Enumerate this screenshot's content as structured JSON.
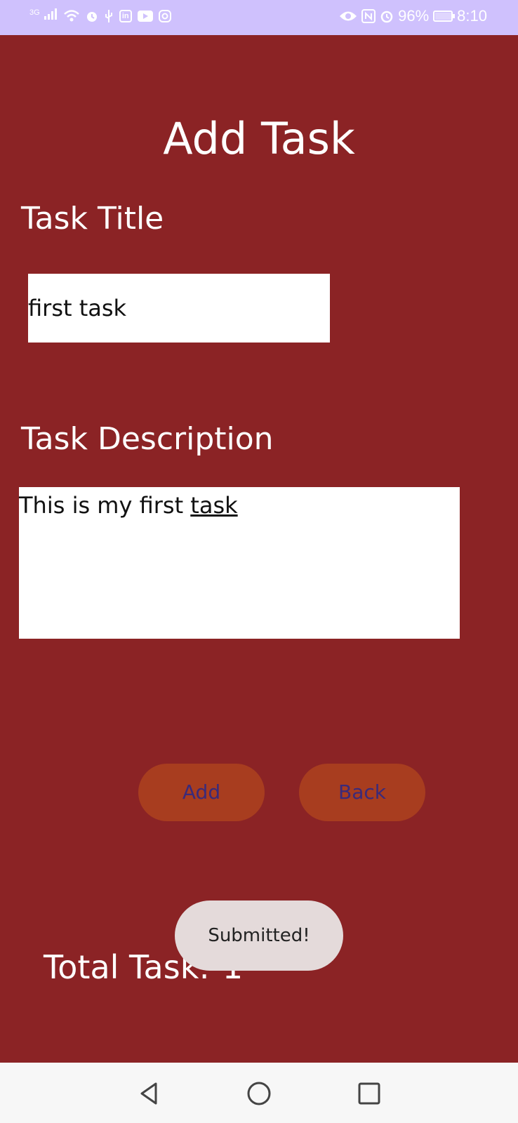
{
  "status_bar": {
    "network_type": "3G",
    "battery_percent": "96%",
    "time": "8:10",
    "background_color": "#cfc1fd",
    "icons": [
      "signal-icon",
      "wifi-icon",
      "alarm-icon",
      "usb-icon",
      "linkedin-icon",
      "youtube-icon",
      "instagram-icon",
      "eye-icon",
      "nfc-icon",
      "alarm-icon",
      "battery-icon"
    ]
  },
  "screen": {
    "title": "Add Task",
    "background_color": "#8b2325"
  },
  "form": {
    "task_title_label": "Task Title",
    "task_title_value": "first task",
    "task_description_label": "Task Description",
    "task_description_value_main": "This is my first ",
    "task_description_value_underlined": "task"
  },
  "buttons": {
    "add_label": "Add",
    "back_label": "Back",
    "button_color": "#a83d1f",
    "button_text_color": "#3a2a7a"
  },
  "summary": {
    "total_label": "Total Task:",
    "total_count": "1"
  },
  "toast": {
    "message": "Submitted!"
  },
  "nav_bar": {
    "back_icon": "triangle-back-icon",
    "home_icon": "circle-home-icon",
    "recents_icon": "square-recents-icon"
  }
}
